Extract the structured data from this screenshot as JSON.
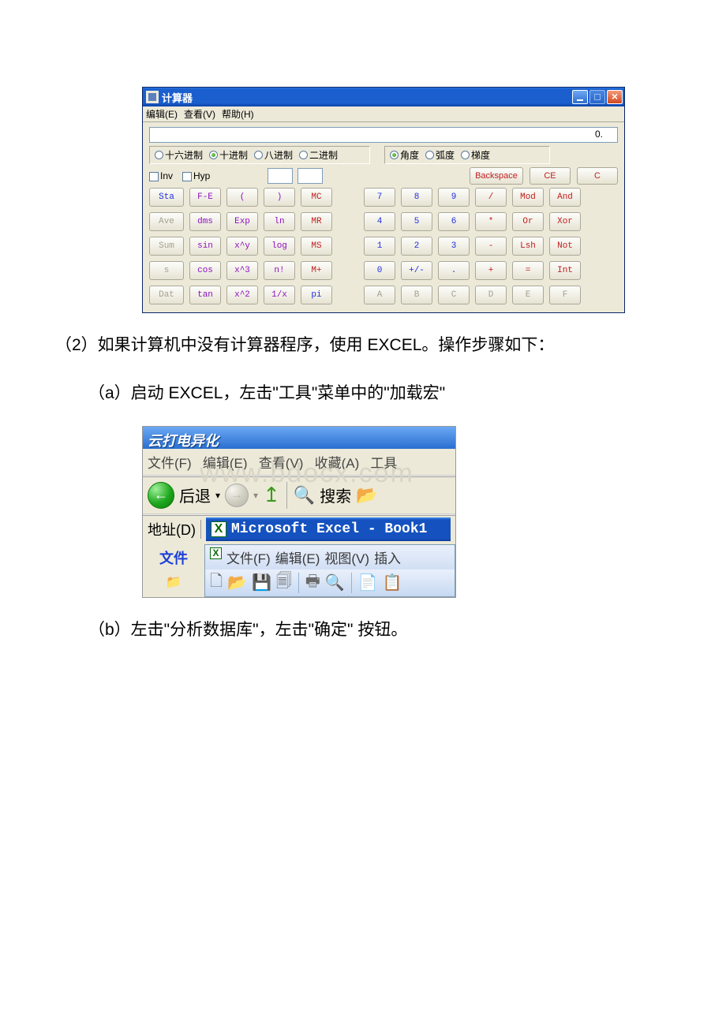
{
  "calc": {
    "title": "计算器",
    "menu": {
      "edit": "编辑(E)",
      "view": "查看(V)",
      "help": "帮助(H)"
    },
    "display": "0.",
    "bases": {
      "hex": "十六进制",
      "dec": "十进制",
      "oct": "八进制",
      "bin": "二进制",
      "selected": "dec"
    },
    "angle": {
      "deg": "角度",
      "rad": "弧度",
      "grad": "梯度",
      "selected": "deg"
    },
    "checks": {
      "inv": "Inv",
      "hyp": "Hyp"
    },
    "topbtn": {
      "backspace": "Backspace",
      "ce": "CE",
      "c": "C"
    },
    "leftgrid": [
      [
        "Sta",
        "F-E",
        "(",
        ")",
        "MC"
      ],
      [
        "Ave",
        "dms",
        "Exp",
        "ln",
        "MR"
      ],
      [
        "Sum",
        "sin",
        "x^y",
        "log",
        "MS"
      ],
      [
        "s",
        "cos",
        "x^3",
        "n!",
        "M+"
      ],
      [
        "Dat",
        "tan",
        "x^2",
        "1/x",
        "pi"
      ]
    ],
    "rightgrid": [
      [
        "7",
        "8",
        "9",
        "/",
        "Mod",
        "And"
      ],
      [
        "4",
        "5",
        "6",
        "*",
        "Or",
        "Xor"
      ],
      [
        "1",
        "2",
        "3",
        "-",
        "Lsh",
        "Not"
      ],
      [
        "0",
        "+/-",
        ".",
        "+",
        "=",
        "Int"
      ],
      [
        "A",
        "B",
        "C",
        "D",
        "E",
        "F"
      ]
    ]
  },
  "text": {
    "p2": "（2）如果计算机中没有计算器程序，使用 EXCEL。操作步骤如下：",
    "pa": "（a）启动 EXCEL，左击\"工具\"菜单中的\"加载宏\"",
    "pb": "（b）左击\"分析数据库\"，左击\"确定\" 按钮。"
  },
  "excel": {
    "ie_title": "云打电异化",
    "watermark": "www.bdocx.com",
    "ie_menu": {
      "file": "文件(F)",
      "edit": "编辑(E)",
      "view": "查看(V)",
      "fav": "收藏(A)",
      "tool": "工具"
    },
    "back": "后退",
    "search": "搜索",
    "addr": "地址(D)",
    "excel_title": "Microsoft Excel - Book1",
    "files": "文件",
    "xl_menu": {
      "file": "文件(F)",
      "edit": "编辑(E)",
      "view": "视图(V)",
      "insert": "插入"
    }
  }
}
